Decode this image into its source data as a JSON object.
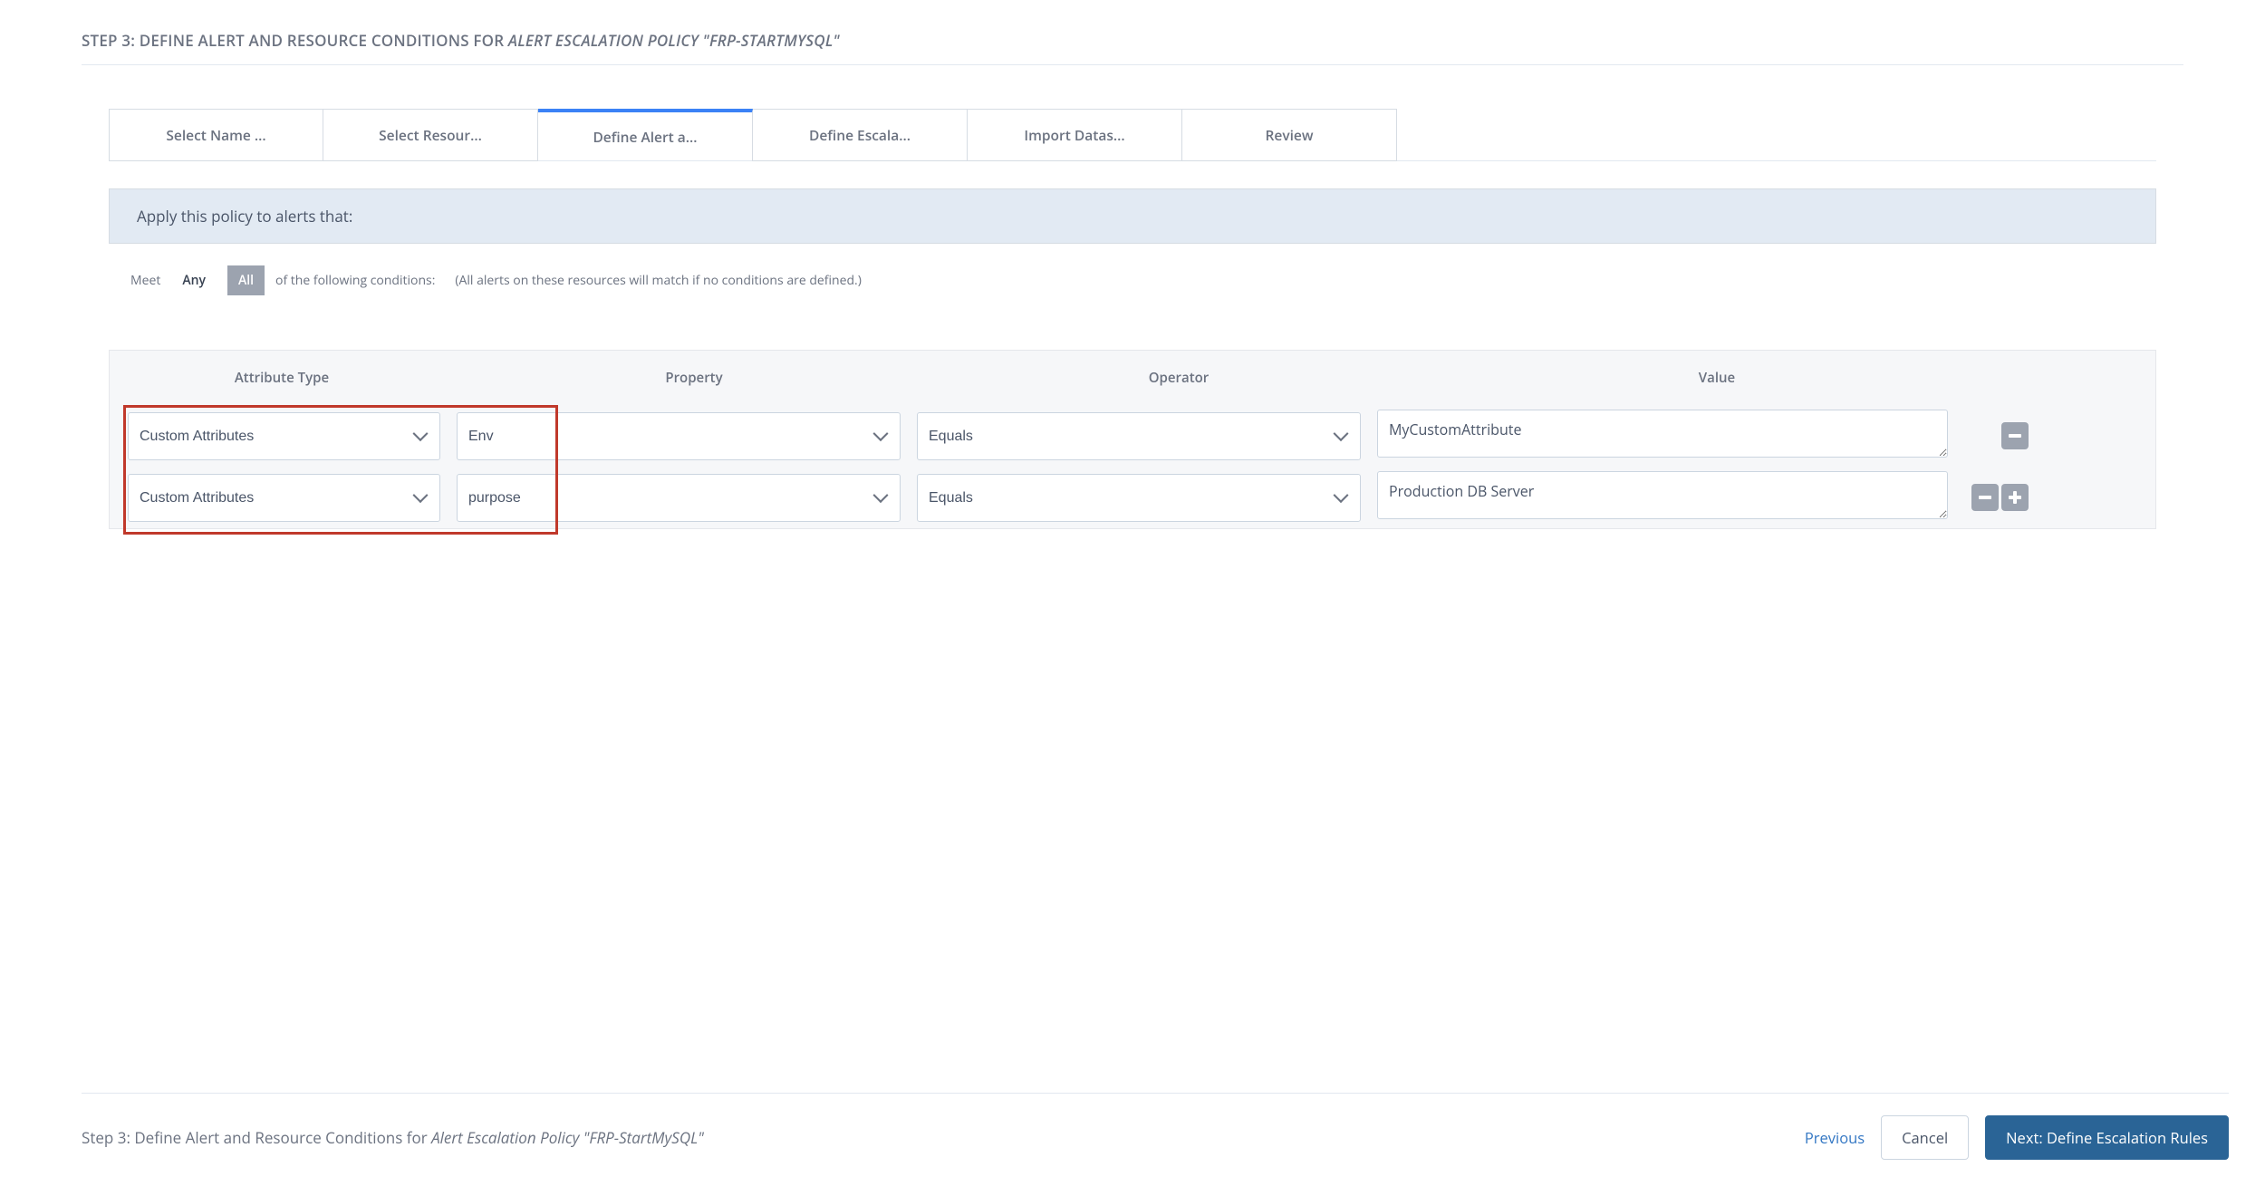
{
  "header": {
    "prefix": "STEP 3: DEFINE ALERT AND RESOURCE CONDITIONS FOR ",
    "italic": "ALERT ESCALATION POLICY \"FRP-STARTMYSQL\""
  },
  "tabs": [
    {
      "label": "Select Name ...",
      "active": false
    },
    {
      "label": "Select Resour...",
      "active": false
    },
    {
      "label": "Define Alert a...",
      "active": true
    },
    {
      "label": "Define Escala...",
      "active": false
    },
    {
      "label": "Import Datas...",
      "active": false
    },
    {
      "label": "Review",
      "active": false
    }
  ],
  "bluebar": "Apply this policy to alerts that:",
  "meetline": {
    "meet": "Meet",
    "any": "Any",
    "all": "All",
    "selected": "all",
    "rest": "of the following conditions:",
    "hint": "(All alerts on these resources will match if no conditions are defined.)"
  },
  "columns": {
    "attr": "Attribute Type",
    "prop": "Property",
    "op": "Operator",
    "val": "Value"
  },
  "rows": [
    {
      "attr": "Custom Attributes",
      "prop": "Env",
      "op": "Equals",
      "val": "MyCustomAttribute",
      "can_add": false
    },
    {
      "attr": "Custom Attributes",
      "prop": "purpose",
      "op": "Equals",
      "val": "Production DB Server",
      "can_add": true
    }
  ],
  "footer": {
    "prefix": "Step 3: Define Alert and Resource Conditions for ",
    "italic": "Alert Escalation Policy \"FRP-StartMySQL\"",
    "previous": "Previous",
    "cancel": "Cancel",
    "next": "Next: Define Escalation Rules"
  }
}
